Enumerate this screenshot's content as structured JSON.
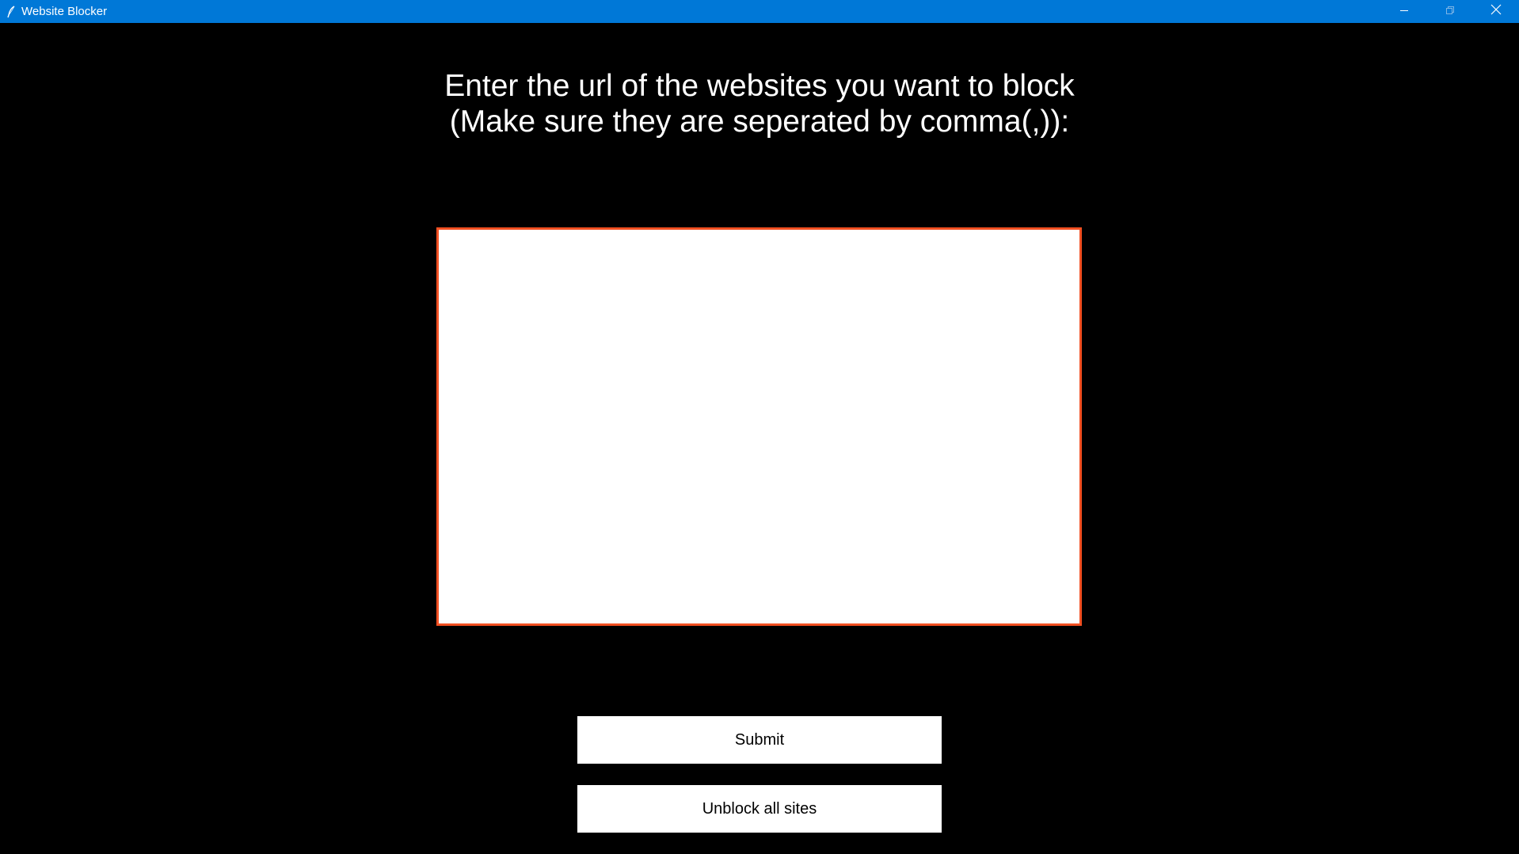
{
  "window": {
    "title": "Website Blocker",
    "icon": "feather-icon",
    "controls": [
      "minimize-icon",
      "restore-icon",
      "close-icon"
    ],
    "titlebar_color": "#0078d7"
  },
  "main": {
    "prompt_line1": "Enter the url of the websites you want to block",
    "prompt_line2": "(Make sure they are seperated by comma(,)):",
    "url_input_value": "",
    "input_border_color": "#f25022",
    "background_color": "#000000"
  },
  "buttons": {
    "submit_label": "Submit",
    "unblock_label": "Unblock all sites"
  }
}
